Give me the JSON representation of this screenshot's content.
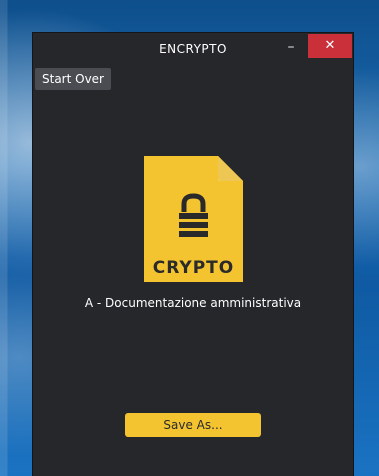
{
  "window": {
    "title": "ENCRYPTO",
    "minimize_glyph": "–",
    "close_glyph": "✕"
  },
  "toolbar": {
    "start_over_label": "Start Over"
  },
  "file": {
    "icon": "encrypted-file-icon",
    "icon_label": "CRYPTO",
    "name": "A - Documentazione amministrativa"
  },
  "actions": {
    "save_as_label": "Save As..."
  },
  "colors": {
    "window_bg": "#26272b",
    "accent_yellow": "#f3c330",
    "close_red": "#c9303a"
  }
}
